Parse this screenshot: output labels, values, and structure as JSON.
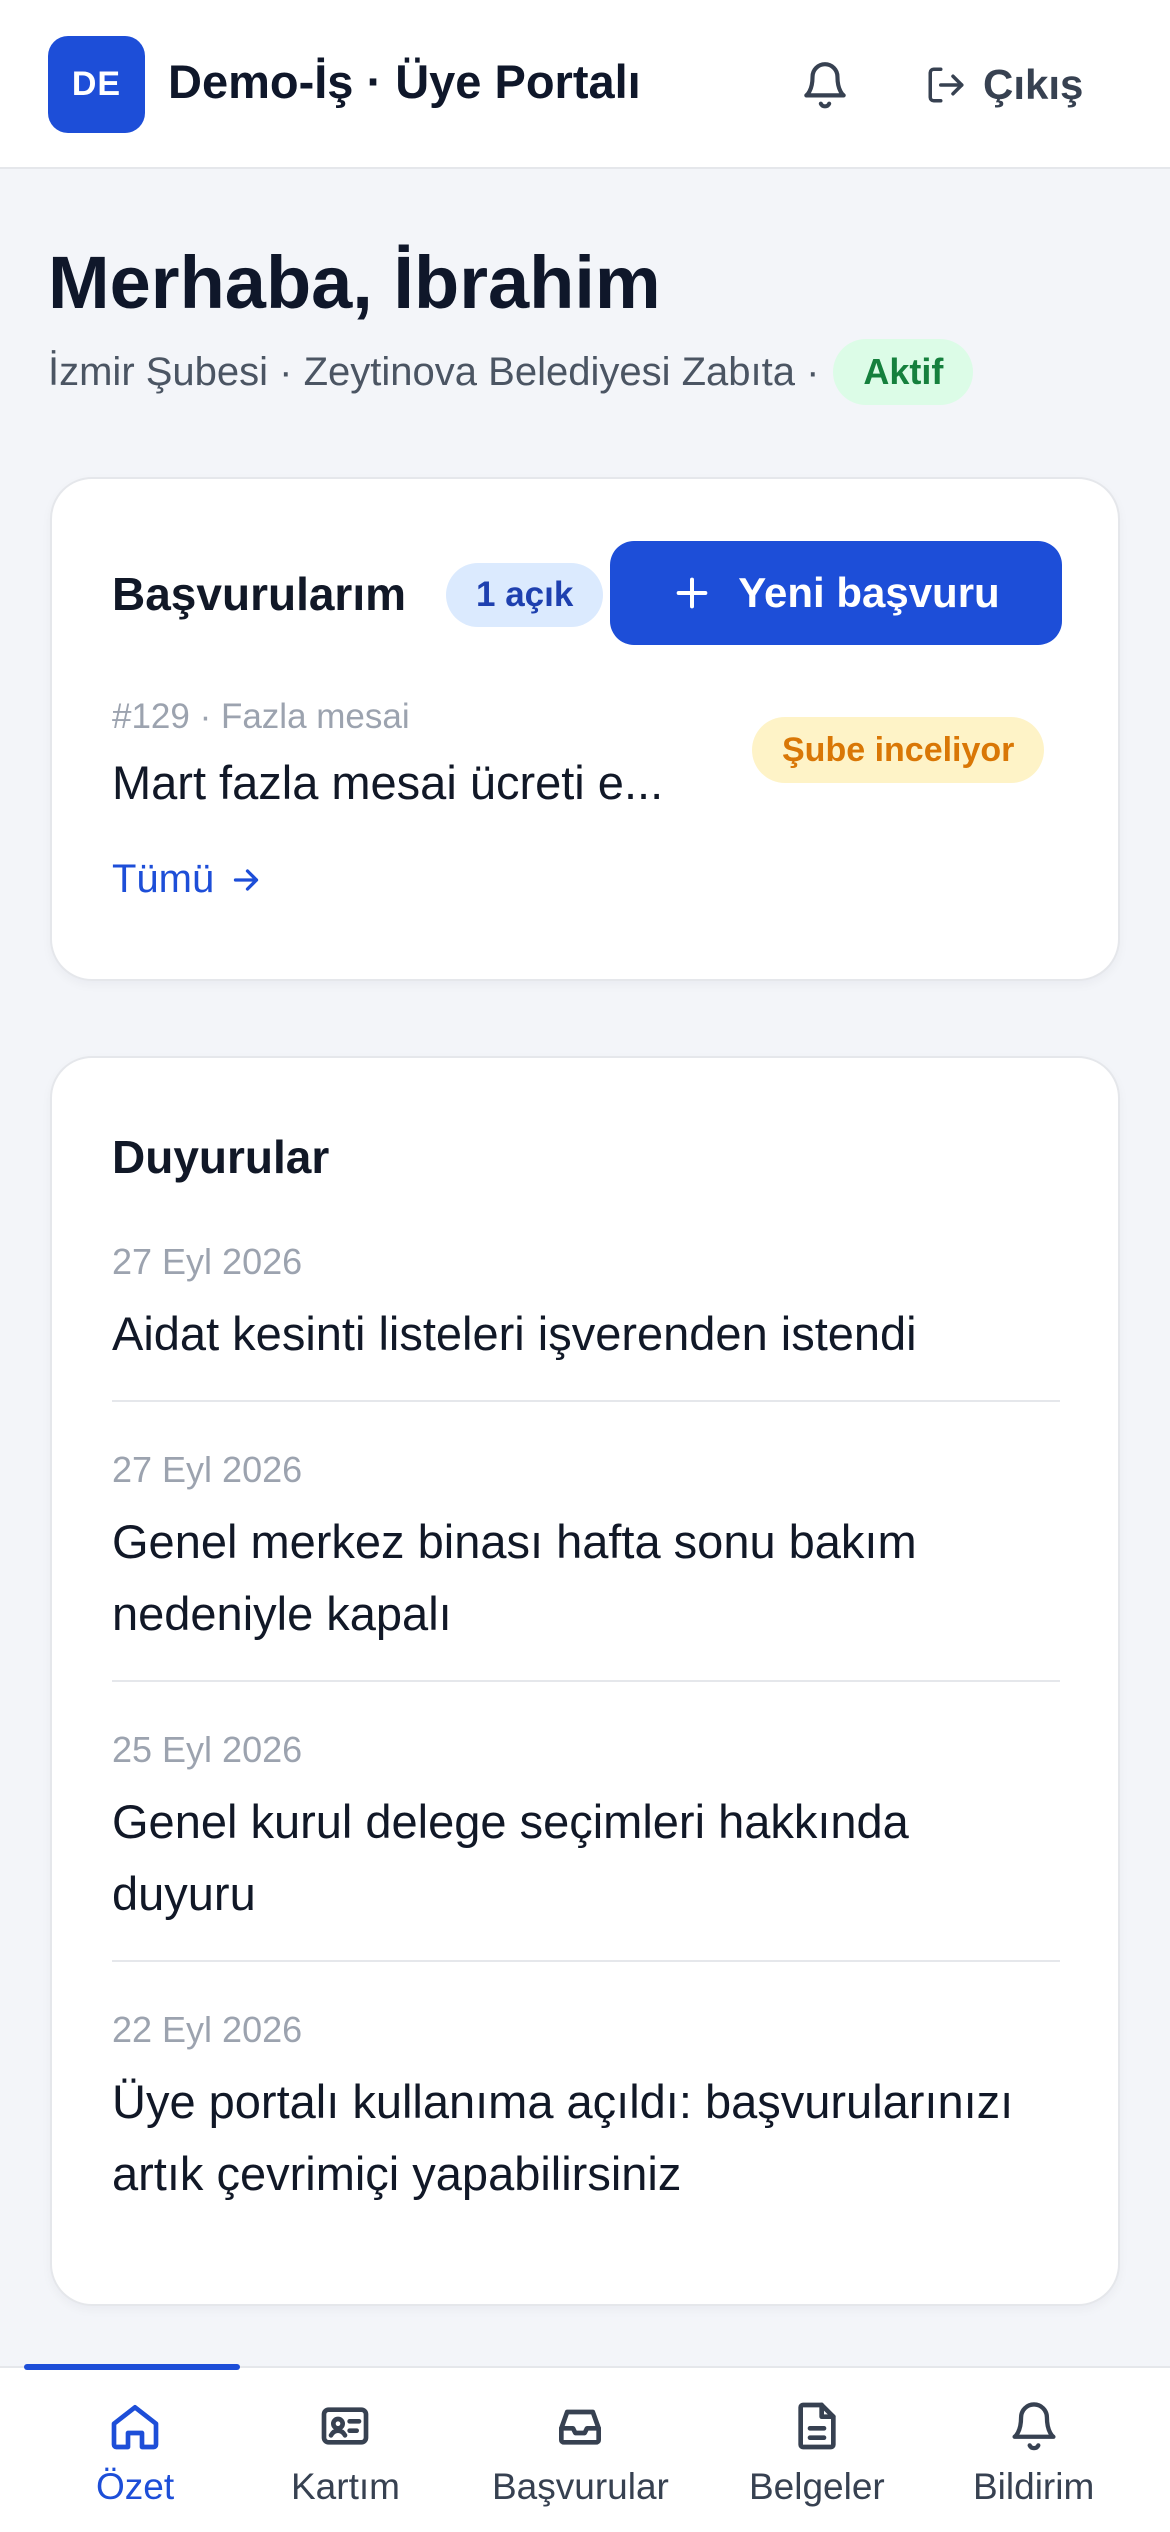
{
  "header": {
    "logo_initials": "DE",
    "app_title": "Demo-İş · Üye Portalı",
    "logout_label": "Çıkış"
  },
  "greeting": {
    "title": "Merhaba, İbrahim",
    "subtitle": "İzmir Şubesi · Zeytinova Belediyesi Zabıta ·",
    "status": "Aktif"
  },
  "applications": {
    "title": "Başvurularım",
    "open_badge": "1 açık",
    "new_button": "Yeni başvuru",
    "item": {
      "meta": "#129 · Fazla mesai",
      "title": "Mart fazla mesai ücreti e...",
      "status": "Şube inceliyor"
    },
    "all_link": "Tümü"
  },
  "announcements": {
    "title": "Duyurular",
    "items": [
      {
        "date": "27 Eyl 2026",
        "text": "Aidat kesinti listeleri işverenden istendi"
      },
      {
        "date": "27 Eyl 2026",
        "text": "Genel merkez binası hafta sonu bakım nedeniyle kapalı"
      },
      {
        "date": "25 Eyl 2026",
        "text": "Genel kurul delege seçimleri hakkında duyuru"
      },
      {
        "date": "22 Eyl 2026",
        "text": "Üye portalı kullanıma açıldı: başvurularınızı artık çevrimiçi yapabilirsiniz"
      }
    ]
  },
  "nav": {
    "items": [
      {
        "label": "Özet",
        "icon": "home-icon"
      },
      {
        "label": "Kartım",
        "icon": "id-card-icon"
      },
      {
        "label": "Başvurular",
        "icon": "inbox-icon"
      },
      {
        "label": "Belgeler",
        "icon": "document-icon"
      },
      {
        "label": "Bildirim",
        "icon": "bell-icon"
      }
    ],
    "active": "Özet"
  },
  "colors": {
    "primary": "#1d4ed8",
    "active_badge_bg": "#dcfce7",
    "active_badge_text": "#15803d",
    "pending_badge_bg": "#fef3c7",
    "pending_badge_text": "#d97706"
  }
}
